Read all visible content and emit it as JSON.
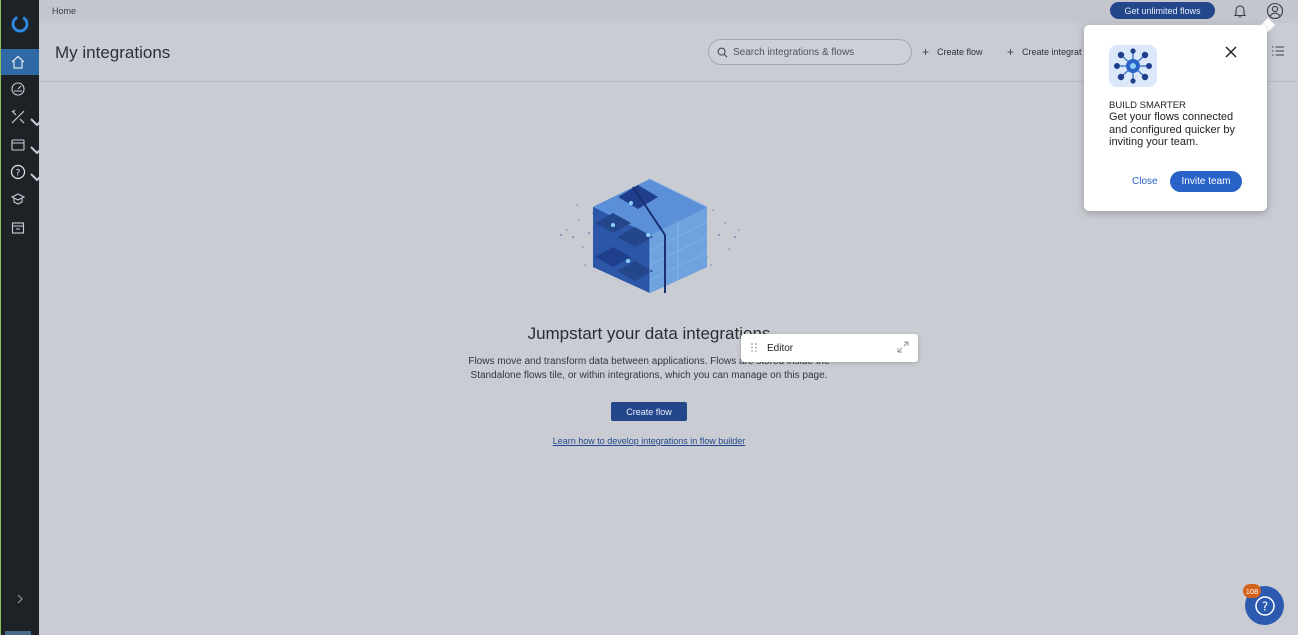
{
  "topbar": {
    "breadcrumb": "Home",
    "unlimited_button": "Get unlimited flows"
  },
  "header": {
    "title": "My integrations",
    "search_placeholder": "Search integrations & flows",
    "create_flow": "Create flow",
    "create_integration": "Create integrat"
  },
  "empty_state": {
    "title": "Jumpstart your data integrations",
    "description_line1": "Flows move and transform data between applications. Flows are stored inside the",
    "description_line2": "Standalone flows tile, or within integrations, which you can manage on this page.",
    "create_flow": "Create flow",
    "learn_link": "Learn how to develop integrations in flow builder"
  },
  "editor_panel": {
    "label": "Editor"
  },
  "popover": {
    "kicker": "BUILD SMARTER",
    "text": "Get your flows connected and configured quicker by inviting your team.",
    "close": "Close",
    "invite": "Invite team"
  },
  "help": {
    "badge": "108"
  },
  "colors": {
    "brand": "#24478c",
    "accent": "#2a63c7",
    "sidebar": "#1d2227",
    "badge": "#d4621a"
  },
  "sidebar_icons": [
    "home-icon",
    "dashboard-icon",
    "tools-icon",
    "resources-icon",
    "help-icon",
    "marketplace-icon",
    "store-icon"
  ]
}
